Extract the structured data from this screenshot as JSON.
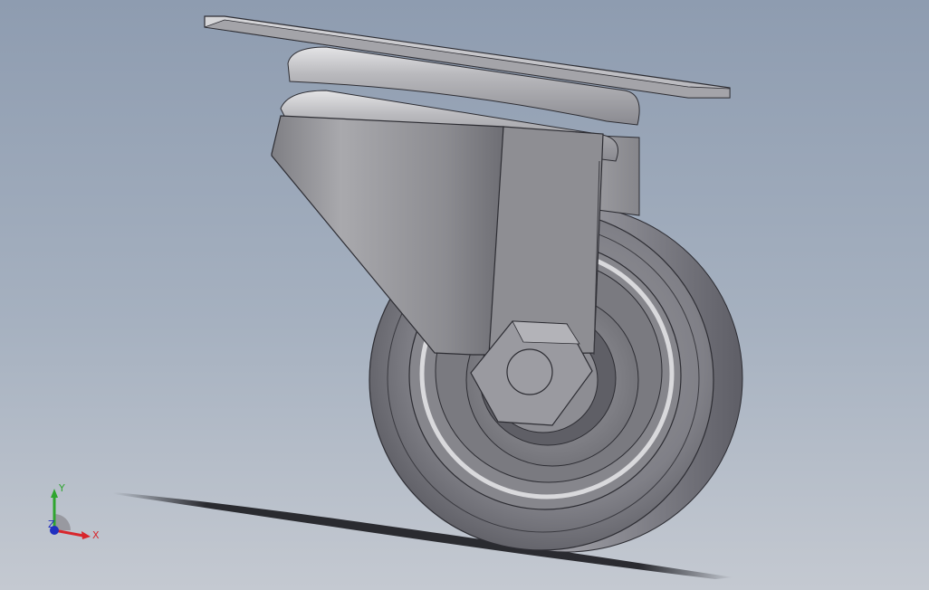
{
  "viewport": {
    "background_top": "#8e9cb0",
    "background_bottom": "#c4c9d1"
  },
  "model": {
    "icon": "caster-wheel-model",
    "part_color": "#8f8f93"
  },
  "triad": {
    "x_label": "X",
    "y_label": "Y",
    "z_label": "Z",
    "x_color": "#d8262c",
    "y_color": "#2fa52f",
    "z_color": "#2030c0"
  }
}
